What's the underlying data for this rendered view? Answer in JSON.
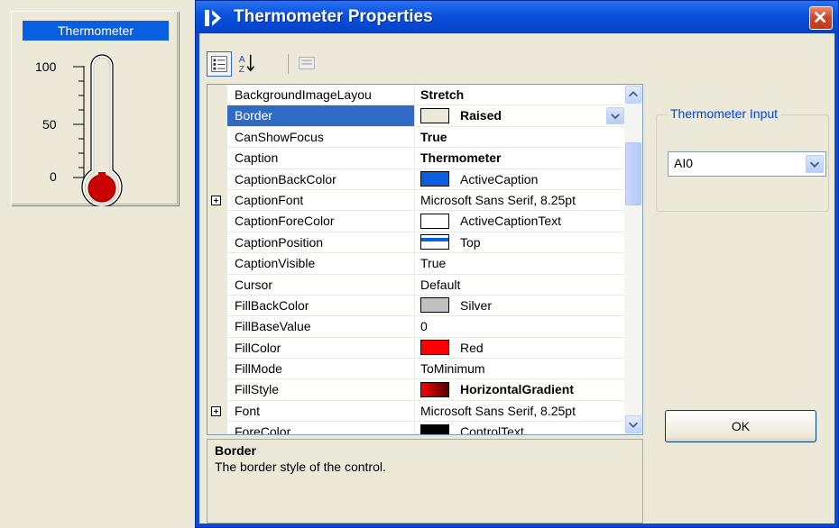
{
  "preview": {
    "caption": "Thermometer",
    "scale": [
      "100",
      "50",
      "0"
    ],
    "colors": {
      "caption_bg": "#0a5fe0",
      "fill": "#cc0000"
    }
  },
  "dialog": {
    "title": "Thermometer Properties",
    "toolbar": {
      "categorized": "categorized-icon",
      "alphabetical": "sort-az-icon",
      "pages": "property-pages-icon"
    },
    "properties": [
      {
        "name": "BackgroundImageLayou",
        "value": "Stretch",
        "bold": true
      },
      {
        "name": "Border",
        "value": "Raised",
        "bold": true,
        "swatch": "#ece9d8",
        "selected": true,
        "dropdown": true
      },
      {
        "name": "CanShowFocus",
        "value": "True",
        "bold": true
      },
      {
        "name": "Caption",
        "value": "Thermometer",
        "bold": true
      },
      {
        "name": "CaptionBackColor",
        "value": "ActiveCaption",
        "swatch": "#0a5fe0"
      },
      {
        "name": "CaptionFont",
        "value": "Microsoft Sans Serif, 8.25pt",
        "expandable": true
      },
      {
        "name": "CaptionForeColor",
        "value": "ActiveCaptionText",
        "swatch": "#ffffff"
      },
      {
        "name": "CaptionPosition",
        "value": "Top",
        "swatch": "caption-top"
      },
      {
        "name": "CaptionVisible",
        "value": "True"
      },
      {
        "name": "Cursor",
        "value": "Default"
      },
      {
        "name": "FillBackColor",
        "value": "Silver",
        "swatch": "#c0c0c0"
      },
      {
        "name": "FillBaseValue",
        "value": "0"
      },
      {
        "name": "FillColor",
        "value": "Red",
        "swatch": "#ff0000"
      },
      {
        "name": "FillMode",
        "value": "ToMinimum"
      },
      {
        "name": "FillStyle",
        "value": "HorizontalGradient",
        "bold": true,
        "swatch": "gradient"
      },
      {
        "name": "Font",
        "value": "Microsoft Sans Serif, 8.25pt",
        "expandable": true
      },
      {
        "name": "ForeColor",
        "value": "ControlText",
        "swatch": "#000000"
      }
    ],
    "description": {
      "title": "Border",
      "text": "The border style of the control."
    },
    "group": {
      "label": "Thermometer Input",
      "selected": "AI0"
    },
    "ok_label": "OK"
  }
}
